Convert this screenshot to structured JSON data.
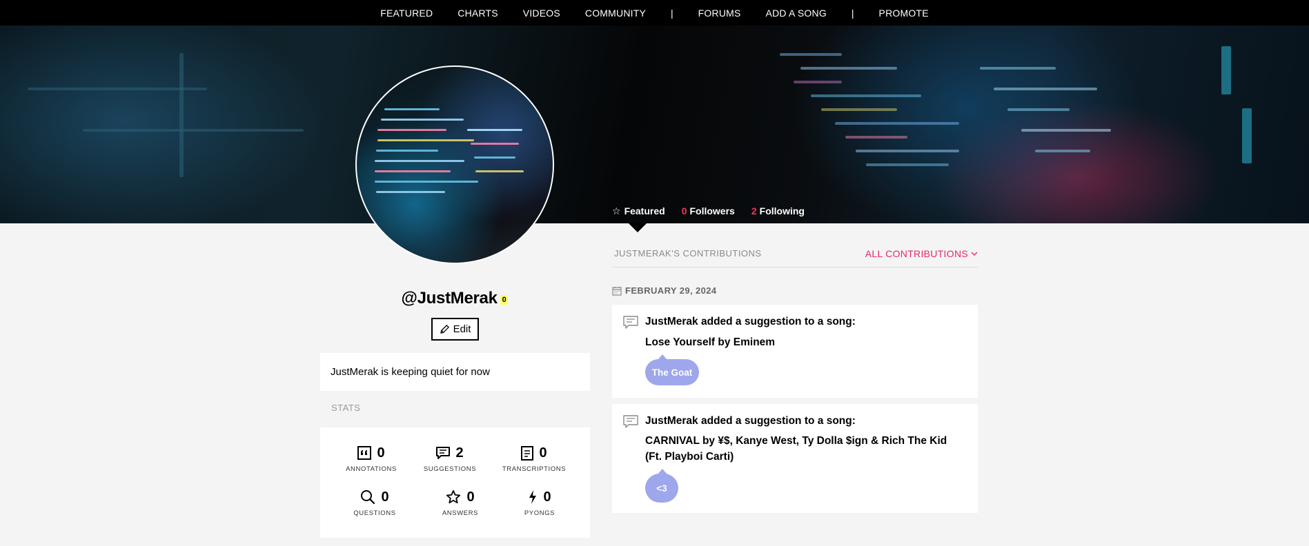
{
  "nav": {
    "items": [
      "FEATURED",
      "CHARTS",
      "VIDEOS",
      "COMMUNITY"
    ],
    "separator": "|",
    "items2": [
      "FORUMS",
      "ADD A SONG"
    ],
    "items3": [
      "PROMOTE"
    ]
  },
  "profile": {
    "username": "@JustMerak",
    "iq": "0",
    "edit_label": "Edit",
    "about": "JustMerak is keeping quiet for now",
    "stats_label": "STATS"
  },
  "tabs": {
    "featured": "Featured",
    "followers_count": "0",
    "followers_label": "Followers",
    "following_count": "2",
    "following_label": "Following"
  },
  "stats": [
    {
      "value": "0",
      "label": "ANNOTATIONS",
      "icon": "quote-icon"
    },
    {
      "value": "2",
      "label": "SUGGESTIONS",
      "icon": "comment-icon"
    },
    {
      "value": "0",
      "label": "TRANSCRIPTIONS",
      "icon": "document-icon"
    },
    {
      "value": "0",
      "label": "QUESTIONS",
      "icon": "search-icon"
    },
    {
      "value": "0",
      "label": "ANSWERS",
      "icon": "star-icon"
    },
    {
      "value": "0",
      "label": "PYONGS",
      "icon": "pyong-icon"
    }
  ],
  "contributions": {
    "title": "JUSTMERAK'S CONTRIBUTIONS",
    "filter": "ALL CONTRIBUTIONS",
    "date": "FEBRUARY 29, 2024",
    "items": [
      {
        "action": "JustMerak added a suggestion to a song:",
        "song": "Lose Yourself by Eminem",
        "suggestion": "The Goat"
      },
      {
        "action": "JustMerak added a suggestion to a song:",
        "song": "CARNIVAL by ¥$, Kanye West, Ty Dolla $ign & Rich The Kid (Ft. Playboi Carti)",
        "suggestion": "<3"
      }
    ]
  },
  "colors": {
    "accent": "#ff2e62",
    "link_pink": "#e8256a",
    "bubble": "#9ea6ec",
    "iq_badge": "#ffff64"
  }
}
